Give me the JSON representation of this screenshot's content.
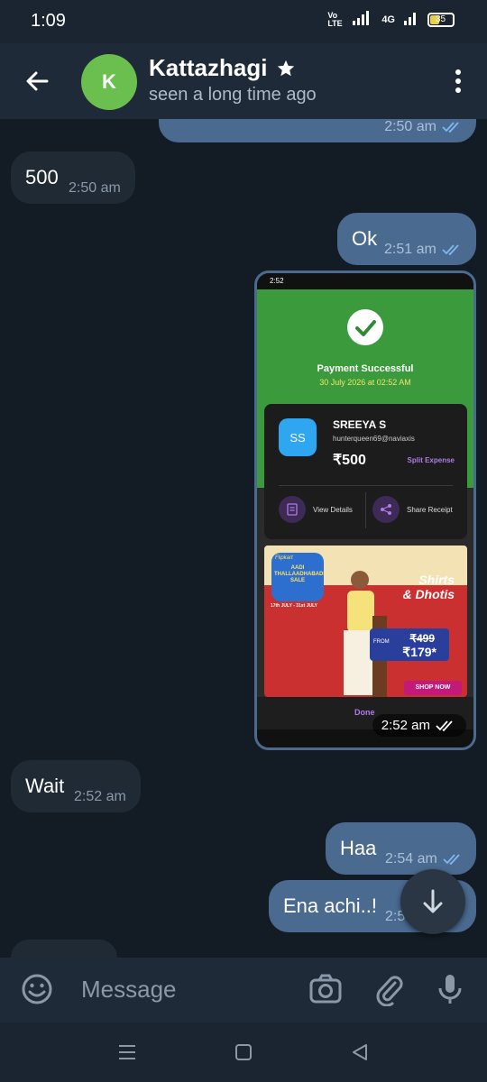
{
  "status_bar": {
    "time": "1:09",
    "network_label": "Vo LTE",
    "data_label": "4G",
    "battery": "35"
  },
  "header": {
    "avatar_letter": "K",
    "contact_name": "Kattazhagi",
    "status": "seen a long time ago"
  },
  "messages": [
    {
      "direction": "out",
      "text": "",
      "time": "2:50 am",
      "read": true
    },
    {
      "direction": "in",
      "text": "500",
      "time": "2:50 am"
    },
    {
      "direction": "out",
      "text": "Ok",
      "time": "2:51 am",
      "read": true
    },
    {
      "direction": "out",
      "type": "image",
      "time": "2:52 am",
      "read": true
    },
    {
      "direction": "in",
      "text": "Wait",
      "time": "2:52 am"
    },
    {
      "direction": "out",
      "text": "Haa",
      "time": "2:54 am",
      "read": true
    },
    {
      "direction": "out",
      "text": "Ena achi..!",
      "time": "2:5",
      "read": false
    }
  ],
  "screenshot": {
    "time": "2:52",
    "title": "Payment Successful",
    "date": "30 July 2026 at 02:52 AM",
    "initials": "SS",
    "payee_name": "SREEYA  S",
    "payee_id": "hunterqueen69@naviaxis",
    "amount": "₹500",
    "split_label": "Split Expense",
    "view_details": "View Details",
    "share_receipt": "Share Receipt",
    "ad_brand": "Flipkart",
    "ad_sale": "AADI THALLAADHABADI SALE",
    "ad_dates": "17th JULY - 31st JULY",
    "ad_title_line1": "Shirts",
    "ad_title_line2": "& Dhotis",
    "ad_from": "FROM",
    "ad_old_price": "₹499",
    "ad_new_price": "₹179*",
    "ad_cta": "SHOP NOW",
    "done": "Done"
  },
  "input": {
    "placeholder": "Message"
  },
  "colors": {
    "background": "#131b24",
    "header": "#1f2a38",
    "outgoing_bubble": "#4a6a90",
    "incoming_bubble": "#1f2a35",
    "avatar": "#6bbf4e",
    "read_ticks": "#7fb8f0"
  }
}
